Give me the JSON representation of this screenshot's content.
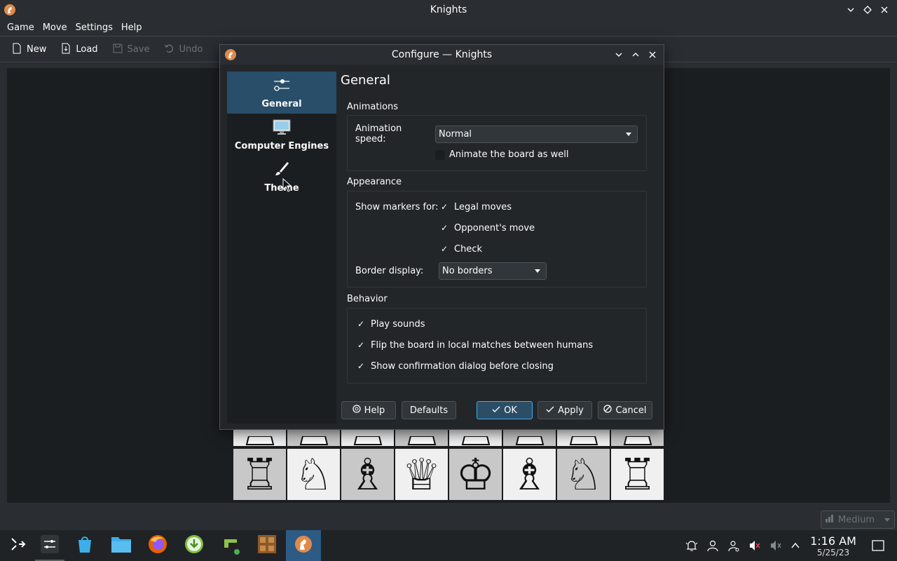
{
  "window": {
    "title": "Knights"
  },
  "menubar": [
    "Game",
    "Move",
    "Settings",
    "Help"
  ],
  "toolbar": {
    "new": "New",
    "load": "Load",
    "save": "Save",
    "undo": "Undo"
  },
  "dialog": {
    "title": "Configure — Knights",
    "sidebar": [
      {
        "label": "General",
        "icon": "sliders-icon"
      },
      {
        "label": "Computer Engines",
        "icon": "monitor-icon"
      },
      {
        "label": "Theme",
        "icon": "brush-icon"
      }
    ],
    "page_title": "General",
    "animations": {
      "header": "Animations",
      "speed_label": "Animation speed:",
      "speed_value": "Normal",
      "animate_board": "Animate the board as well"
    },
    "appearance": {
      "header": "Appearance",
      "markers_label": "Show markers for:",
      "legal_moves": "Legal moves",
      "opponents_move": "Opponent's move",
      "check": "Check",
      "border_label": "Border display:",
      "border_value": "No borders"
    },
    "behavior": {
      "header": "Behavior",
      "play_sounds": "Play sounds",
      "flip_board": "Flip the board in local matches between humans",
      "confirm_close": "Show confirmation dialog before closing"
    },
    "buttons": {
      "help": "Help",
      "defaults": "Defaults",
      "ok": "OK",
      "apply": "Apply",
      "cancel": "Cancel"
    }
  },
  "board": {
    "back_rank": [
      "♖",
      "♘",
      "♗",
      "♕",
      "♔",
      "♗",
      "♘",
      "♖"
    ]
  },
  "quality_combo": "Medium",
  "clock": {
    "time": "1:16 AM",
    "date": "5/25/23"
  },
  "colors": {
    "accent": "#3daee9",
    "selection": "#284e6a",
    "background": "#232629"
  }
}
